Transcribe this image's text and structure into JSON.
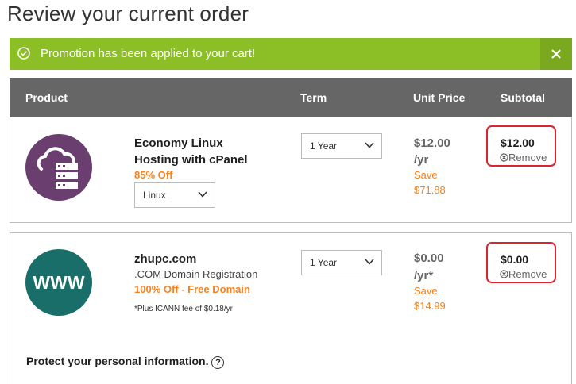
{
  "page": {
    "title": "Review your current order"
  },
  "banner": {
    "message": "Promotion has been applied to your cart!",
    "close_glyph": "✕",
    "color": "#8cbf26"
  },
  "table": {
    "headers": {
      "product": "Product",
      "term": "Term",
      "unit_price": "Unit Price",
      "subtotal": "Subtotal"
    }
  },
  "items": [
    {
      "name_line1": "Economy Linux",
      "name_line2": "Hosting with cPanel",
      "discount": "85% Off",
      "os_select": "Linux",
      "term": "1 Year",
      "price_line1": "$12.00",
      "price_line2": "/yr",
      "save_label": "Save",
      "save_amount": "$71.88",
      "subtotal": "$12.00",
      "remove": "Remove",
      "icon": "hosting-cloud-server-icon"
    },
    {
      "name": "zhupc.com",
      "description": ".COM Domain Registration",
      "discount": "100% Off - Free Domain",
      "note": "*Plus ICANN fee of $0.18/yr",
      "term": "1 Year",
      "price_line1": "$0.00",
      "price_line2": "/yr*",
      "save_label": "Save",
      "save_amount": "$14.99",
      "subtotal": "$0.00",
      "remove": "Remove",
      "icon_text": "WWW",
      "icon": "www-domain-icon",
      "protect": "Protect your personal information.",
      "help_glyph": "?"
    }
  ],
  "colors": {
    "accent_orange": "#f58220",
    "purple_icon": "#6a3e6e",
    "teal_icon": "#1a6e69",
    "highlight_red": "#d9232e",
    "header_gray": "#666666"
  }
}
